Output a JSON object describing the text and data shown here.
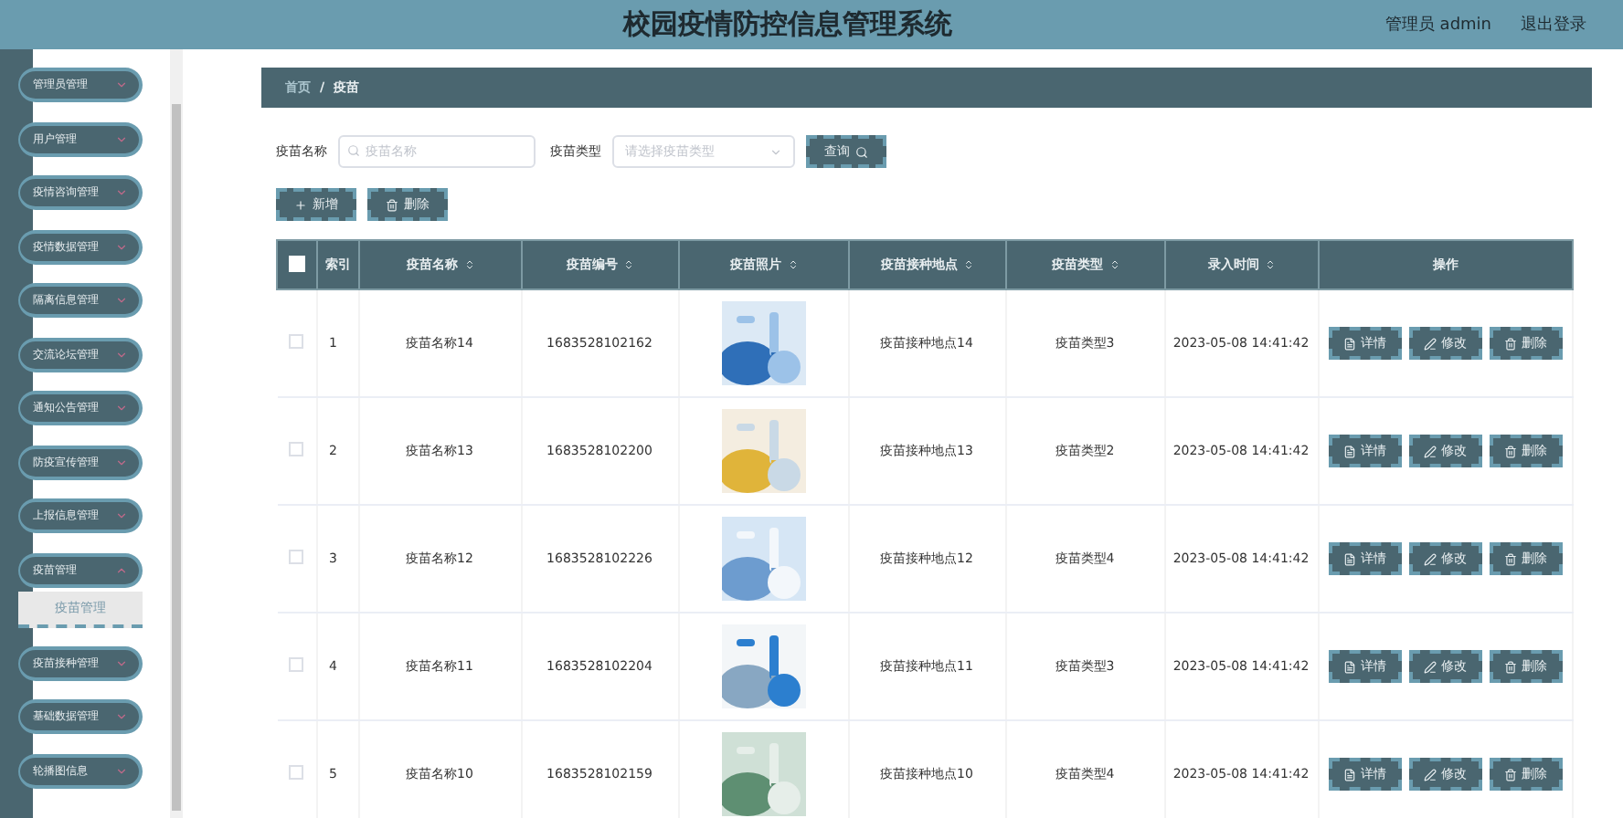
{
  "header": {
    "title": "校园疫情防控信息管理系统",
    "user": "管理员 admin",
    "logout": "退出登录"
  },
  "sidebar": {
    "items": [
      {
        "label": "管理员管理",
        "expanded": false
      },
      {
        "label": "用户管理",
        "expanded": false
      },
      {
        "label": "疫情咨询管理",
        "expanded": false
      },
      {
        "label": "疫情数据管理",
        "expanded": false
      },
      {
        "label": "隔离信息管理",
        "expanded": false
      },
      {
        "label": "交流论坛管理",
        "expanded": false
      },
      {
        "label": "通知公告管理",
        "expanded": false
      },
      {
        "label": "防疫宣传管理",
        "expanded": false
      },
      {
        "label": "上报信息管理",
        "expanded": false
      },
      {
        "label": "疫苗管理",
        "expanded": true,
        "children": [
          {
            "label": "疫苗管理",
            "selected": true
          }
        ]
      },
      {
        "label": "疫苗接种管理",
        "expanded": false
      },
      {
        "label": "基础数据管理",
        "expanded": false
      },
      {
        "label": "轮播图信息",
        "expanded": false
      }
    ]
  },
  "breadcrumb": {
    "home": "首页",
    "separator": "/",
    "current": "疫苗"
  },
  "search": {
    "name_label": "疫苗名称",
    "name_placeholder": "疫苗名称",
    "type_label": "疫苗类型",
    "type_placeholder": "请选择疫苗类型",
    "button": "查询"
  },
  "actions": {
    "add": "新增",
    "delete": "删除"
  },
  "table": {
    "select_all": false,
    "columns": [
      "索引",
      "疫苗名称",
      "疫苗编号",
      "疫苗照片",
      "疫苗接种地点",
      "疫苗类型",
      "录入时间",
      "操作"
    ],
    "rows": [
      {
        "checked": false,
        "index": "1",
        "name": "疫苗名称14",
        "code": "1683528102162",
        "place": "疫苗接种地点14",
        "type": "疫苗类型3",
        "time": "2023-05-08 14:41:42",
        "actions": [
          "详情",
          "修改",
          "删除"
        ]
      },
      {
        "checked": false,
        "index": "2",
        "name": "疫苗名称13",
        "code": "1683528102200",
        "place": "疫苗接种地点13",
        "type": "疫苗类型2",
        "time": "2023-05-08 14:41:42",
        "actions": [
          "详情",
          "修改",
          "删除"
        ]
      },
      {
        "checked": false,
        "index": "3",
        "name": "疫苗名称12",
        "code": "1683528102226",
        "place": "疫苗接种地点12",
        "type": "疫苗类型4",
        "time": "2023-05-08 14:41:42",
        "actions": [
          "详情",
          "修改",
          "删除"
        ]
      },
      {
        "checked": false,
        "index": "4",
        "name": "疫苗名称11",
        "code": "1683528102204",
        "place": "疫苗接种地点11",
        "type": "疫苗类型3",
        "time": "2023-05-08 14:41:42",
        "actions": [
          "详情",
          "修改",
          "删除"
        ]
      },
      {
        "checked": false,
        "index": "5",
        "name": "疫苗名称10",
        "code": "1683528102159",
        "place": "疫苗接种地点10",
        "type": "疫苗类型4",
        "time": "2023-05-08 14:41:42",
        "actions": [
          "详情",
          "修改",
          "删除"
        ]
      }
    ]
  }
}
